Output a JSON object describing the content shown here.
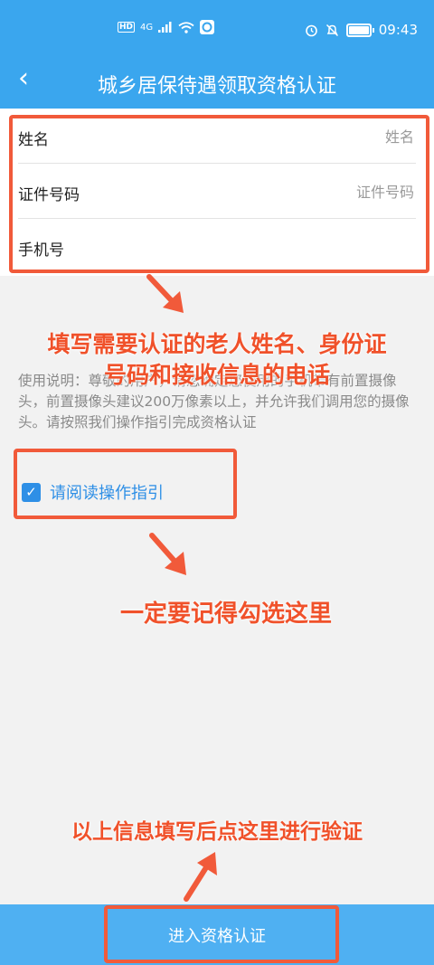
{
  "status_bar": {
    "network_badge": "HD",
    "network_type": "4G",
    "time": "09:43"
  },
  "header": {
    "back_glyph": "‹",
    "title": "城乡居保待遇领取资格认证"
  },
  "form": {
    "name_label": "姓名",
    "name_placeholder": "姓名",
    "id_label": "证件号码",
    "id_placeholder": "证件号码",
    "phone_label": "手机号",
    "phone_placeholder": ""
  },
  "annotations": {
    "fill_hint_line1": "填写需要认证的老人姓名、身份证",
    "fill_hint_line2": "号码和接收信息的电话",
    "check_hint": "一定要记得勾选这里",
    "submit_hint": "以上信息填写后点这里进行验证"
  },
  "usage": {
    "text": "使用说明：尊敬的用户，请您确定您使用的手机带有前置摄像头，前置摄像头建议200万像素以上，并允许我们调用您的摄像头。请按照我们操作指引完成资格认证"
  },
  "checkbox": {
    "checked": true,
    "label": "请阅读操作指引"
  },
  "submit_button": {
    "label": "进入资格认证"
  },
  "colors": {
    "header_bg": "#3aa6ee",
    "annotation": "#f15a3a",
    "link": "#2e8fe6",
    "button_bg": "#4fb0f2"
  }
}
